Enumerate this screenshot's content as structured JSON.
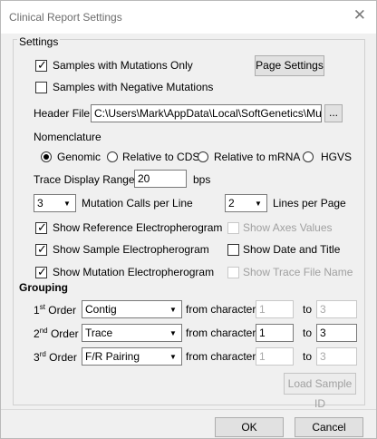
{
  "window": {
    "title": "Clinical Report Settings",
    "close_glyph": "✕"
  },
  "settings": {
    "group_label": "Settings",
    "samples_with_mutations_only": {
      "label": "Samples with Mutations Only",
      "checked": true
    },
    "page_settings_button": "Page Settings",
    "samples_with_negative_mutations": {
      "label": "Samples with Negative Mutations",
      "checked": false
    },
    "header_file": {
      "label": "Header File:",
      "value": "C:\\Users\\Mark\\AppData\\Local\\SoftGenetics\\Muta",
      "browse_label": "..."
    },
    "nomenclature": {
      "label": "Nomenclature",
      "options": [
        "Genomic",
        "Relative to CDS",
        "Relative to mRNA",
        "HGVS"
      ],
      "selected": "Genomic"
    },
    "trace_display_range": {
      "label": "Trace Display Range",
      "value": "20",
      "unit": "bps"
    },
    "mutation_calls_per_line": {
      "value": "3",
      "label": "Mutation Calls per Line"
    },
    "lines_per_page": {
      "value": "2",
      "label": "Lines per Page"
    },
    "checks": {
      "show_reference": {
        "label": "Show Reference Electropherogram",
        "checked": true
      },
      "show_axes": {
        "label": "Show Axes Values",
        "checked": false,
        "disabled": true
      },
      "show_sample": {
        "label": "Show Sample Electropherogram",
        "checked": true
      },
      "show_date": {
        "label": "Show Date and Title",
        "checked": false
      },
      "show_mutation": {
        "label": "Show Mutation Electropherogram",
        "checked": true
      },
      "show_trace_file": {
        "label": "Show Trace File Name",
        "checked": false,
        "disabled": true
      }
    }
  },
  "grouping": {
    "label": "Grouping",
    "order_word": "Order",
    "from_label": "from character",
    "to_label": "to",
    "rows": [
      {
        "num": "1",
        "sup": "st",
        "value": "Contig",
        "from": "1",
        "to": "3",
        "enabled": false
      },
      {
        "num": "2",
        "sup": "nd",
        "value": "Trace",
        "from": "1",
        "to": "3",
        "enabled": true
      },
      {
        "num": "3",
        "sup": "rd",
        "value": "F/R Pairing",
        "from": "1",
        "to": "3",
        "enabled": false
      }
    ],
    "load_sample_id_button": "Load Sample ID"
  },
  "buttons": {
    "ok": "OK",
    "cancel": "Cancel"
  }
}
